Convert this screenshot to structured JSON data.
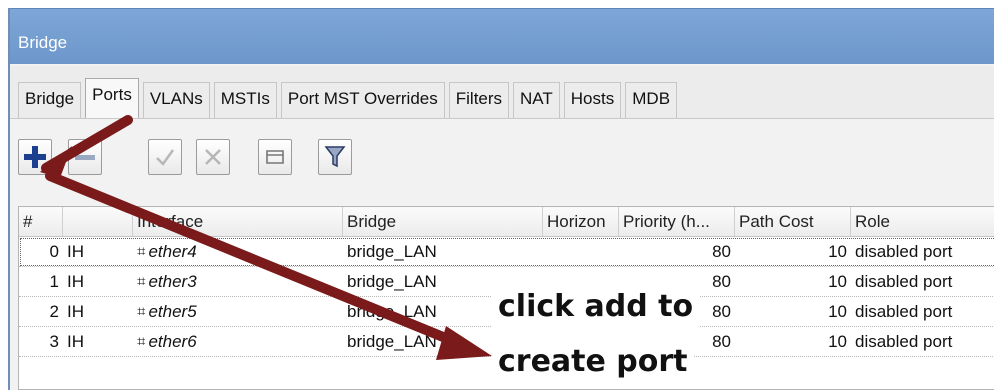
{
  "window": {
    "title": "Bridge"
  },
  "tabs": [
    {
      "label": "Bridge"
    },
    {
      "label": "Ports",
      "active": true
    },
    {
      "label": "VLANs"
    },
    {
      "label": "MSTIs"
    },
    {
      "label": "Port MST Overrides"
    },
    {
      "label": "Filters"
    },
    {
      "label": "NAT"
    },
    {
      "label": "Hosts"
    },
    {
      "label": "MDB"
    }
  ],
  "toolbar": {
    "buttons": [
      {
        "name": "add-button",
        "icon": "plus-icon"
      },
      {
        "name": "remove-button",
        "icon": "minus-icon"
      },
      {
        "name": "enable-button",
        "icon": "check-icon"
      },
      {
        "name": "disable-button",
        "icon": "cross-icon"
      },
      {
        "name": "comment-button",
        "icon": "note-icon"
      },
      {
        "name": "filter-button",
        "icon": "filter-icon"
      }
    ]
  },
  "table": {
    "columns": [
      "#",
      "",
      "Interface",
      "Bridge",
      "Horizon",
      "Priority (h...",
      "Path Cost",
      "Role"
    ],
    "rows": [
      {
        "num": "0",
        "flags": "IH",
        "interface": "ether4",
        "bridge": "bridge_LAN",
        "horizon": "",
        "priority": "80",
        "path_cost": "10",
        "role": "disabled port"
      },
      {
        "num": "1",
        "flags": "IH",
        "interface": "ether3",
        "bridge": "bridge_LAN",
        "horizon": "",
        "priority": "80",
        "path_cost": "10",
        "role": "disabled port"
      },
      {
        "num": "2",
        "flags": "IH",
        "interface": "ether5",
        "bridge": "bridge_LAN",
        "horizon": "",
        "priority": "80",
        "path_cost": "10",
        "role": "disabled port"
      },
      {
        "num": "3",
        "flags": "IH",
        "interface": "ether6",
        "bridge": "bridge_LAN",
        "horizon": "",
        "priority": "80",
        "path_cost": "10",
        "role": "disabled port"
      }
    ]
  },
  "annotation": {
    "line1": "click add to",
    "line2": "create port",
    "arrow_color": "#7a1a1a"
  },
  "colors": {
    "titlebar": "#7ea6d6",
    "add_icon": "#1c3f8f",
    "arrow": "#7a1a1a"
  }
}
